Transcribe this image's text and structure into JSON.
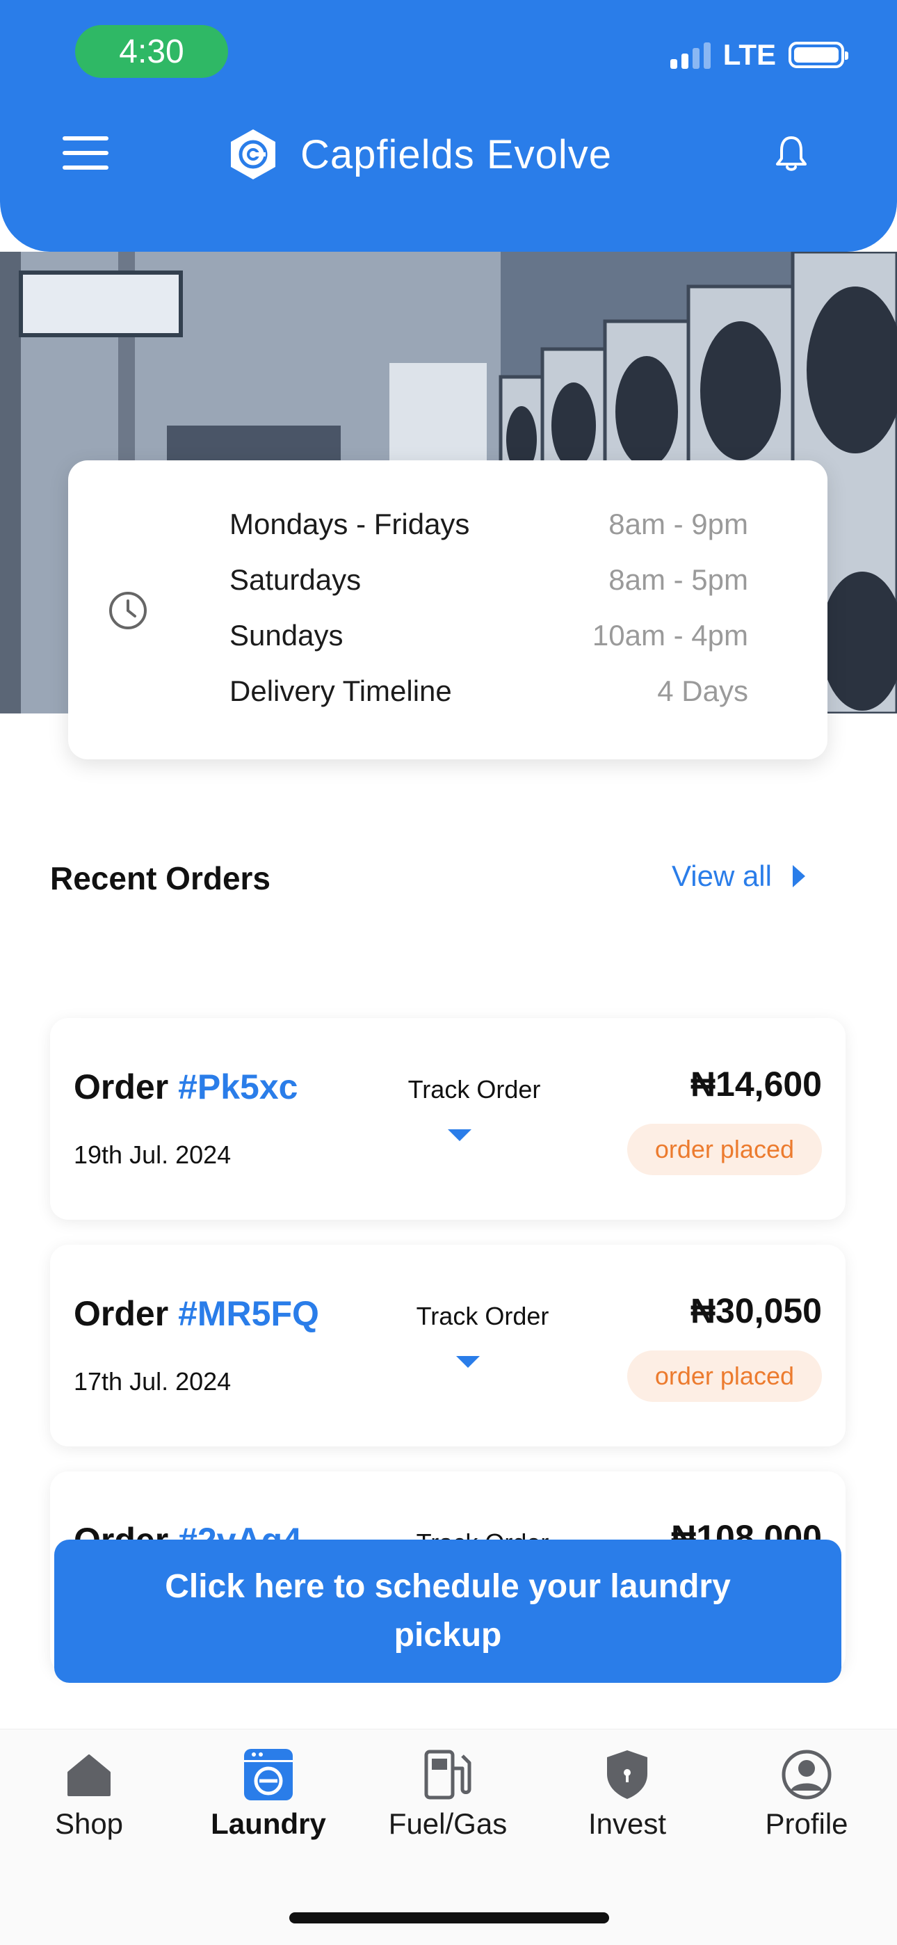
{
  "status_bar": {
    "time": "4:30",
    "network": "LTE"
  },
  "header": {
    "app_name": "Capfields Evolve"
  },
  "hours": [
    {
      "day": "Mondays - Fridays",
      "hours": "8am - 9pm"
    },
    {
      "day": "Saturdays",
      "hours": "8am - 5pm"
    },
    {
      "day": "Sundays",
      "hours": "10am - 4pm"
    },
    {
      "day": "Delivery Timeline",
      "hours": "4 Days"
    }
  ],
  "recent_orders": {
    "title": "Recent Orders",
    "view_all": "View all",
    "orders": [
      {
        "label": "Order",
        "id": "#Pk5xc",
        "date": "19th Jul. 2024",
        "track": "Track Order",
        "amount": "₦14,600",
        "status": "order placed"
      },
      {
        "label": "Order",
        "id": "#MR5FQ",
        "date": "17th Jul. 2024",
        "track": "Track Order",
        "amount": "₦30,050",
        "status": "order placed"
      },
      {
        "label": "Order",
        "id": "#2vAq4",
        "date": "",
        "track": "Track Order",
        "amount": "₦108,000",
        "status": ""
      }
    ]
  },
  "cta": {
    "label": "Click here to schedule your laundry pickup"
  },
  "tabs": [
    {
      "label": "Shop",
      "icon": "home-icon",
      "active": false
    },
    {
      "label": "Laundry",
      "icon": "washing-machine-icon",
      "active": true
    },
    {
      "label": "Fuel/Gas",
      "icon": "fuel-pump-icon",
      "active": false
    },
    {
      "label": "Invest",
      "icon": "shield-icon",
      "active": false
    },
    {
      "label": "Profile",
      "icon": "user-icon",
      "active": false
    }
  ],
  "colors": {
    "primary": "#2a7de9",
    "status_green": "#2fb865",
    "badge_bg": "#fdeee4",
    "badge_text": "#ec7b2e"
  }
}
